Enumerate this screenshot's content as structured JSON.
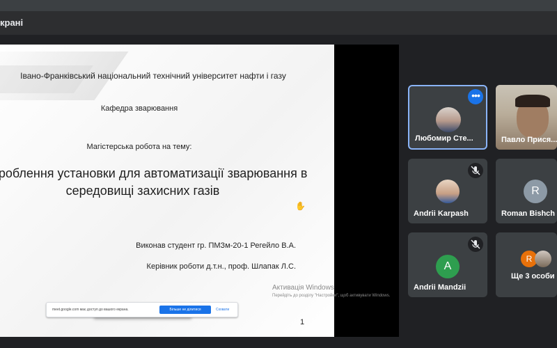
{
  "window": {
    "title": "крані"
  },
  "slide": {
    "university": "Івано-Франківський національний технічний університет нафти і газу",
    "department": "Кафедра зварювання",
    "thesis_label": "Магістерська робота на тему:",
    "thesis_title": "Розроблення установки для автоматизації зварювання в середовищі захисних газів",
    "author": "Виконав студент гр. ПМЗм-20-1 Регейло В.А.",
    "supervisor": "Керівник роботи д.т.н., проф. Шлапак Л.С.",
    "page_number": "1"
  },
  "share_bar": {
    "message": "meet.google.com має доступ до вашого екрана.",
    "stop_label": "Більше не ділитися",
    "hide_label": "Сховати"
  },
  "activation": {
    "title": "Активація Windows",
    "description": "Перейдіть до розділу \"Настройки\", щоб активувати Windows."
  },
  "participants": [
    {
      "name": "Любомир Сте...",
      "type": "video",
      "active": true
    },
    {
      "name": "Павло Прися...",
      "type": "video"
    },
    {
      "name": "Andrii Karpash",
      "type": "photo",
      "muted": true
    },
    {
      "name": "Roman Bishch",
      "type": "initial",
      "initial": "R",
      "color": "#8d9aa6"
    },
    {
      "name": "Andrii Mandzii",
      "type": "initial",
      "initial": "A",
      "color": "#2e9e4f",
      "muted": true
    },
    {
      "name": "Ще 3 особи",
      "type": "group",
      "initial": "R",
      "color": "#e8710a"
    }
  ],
  "colors": {
    "accent": "#1a73e8",
    "tile": "#3c4043",
    "background": "#202124"
  }
}
